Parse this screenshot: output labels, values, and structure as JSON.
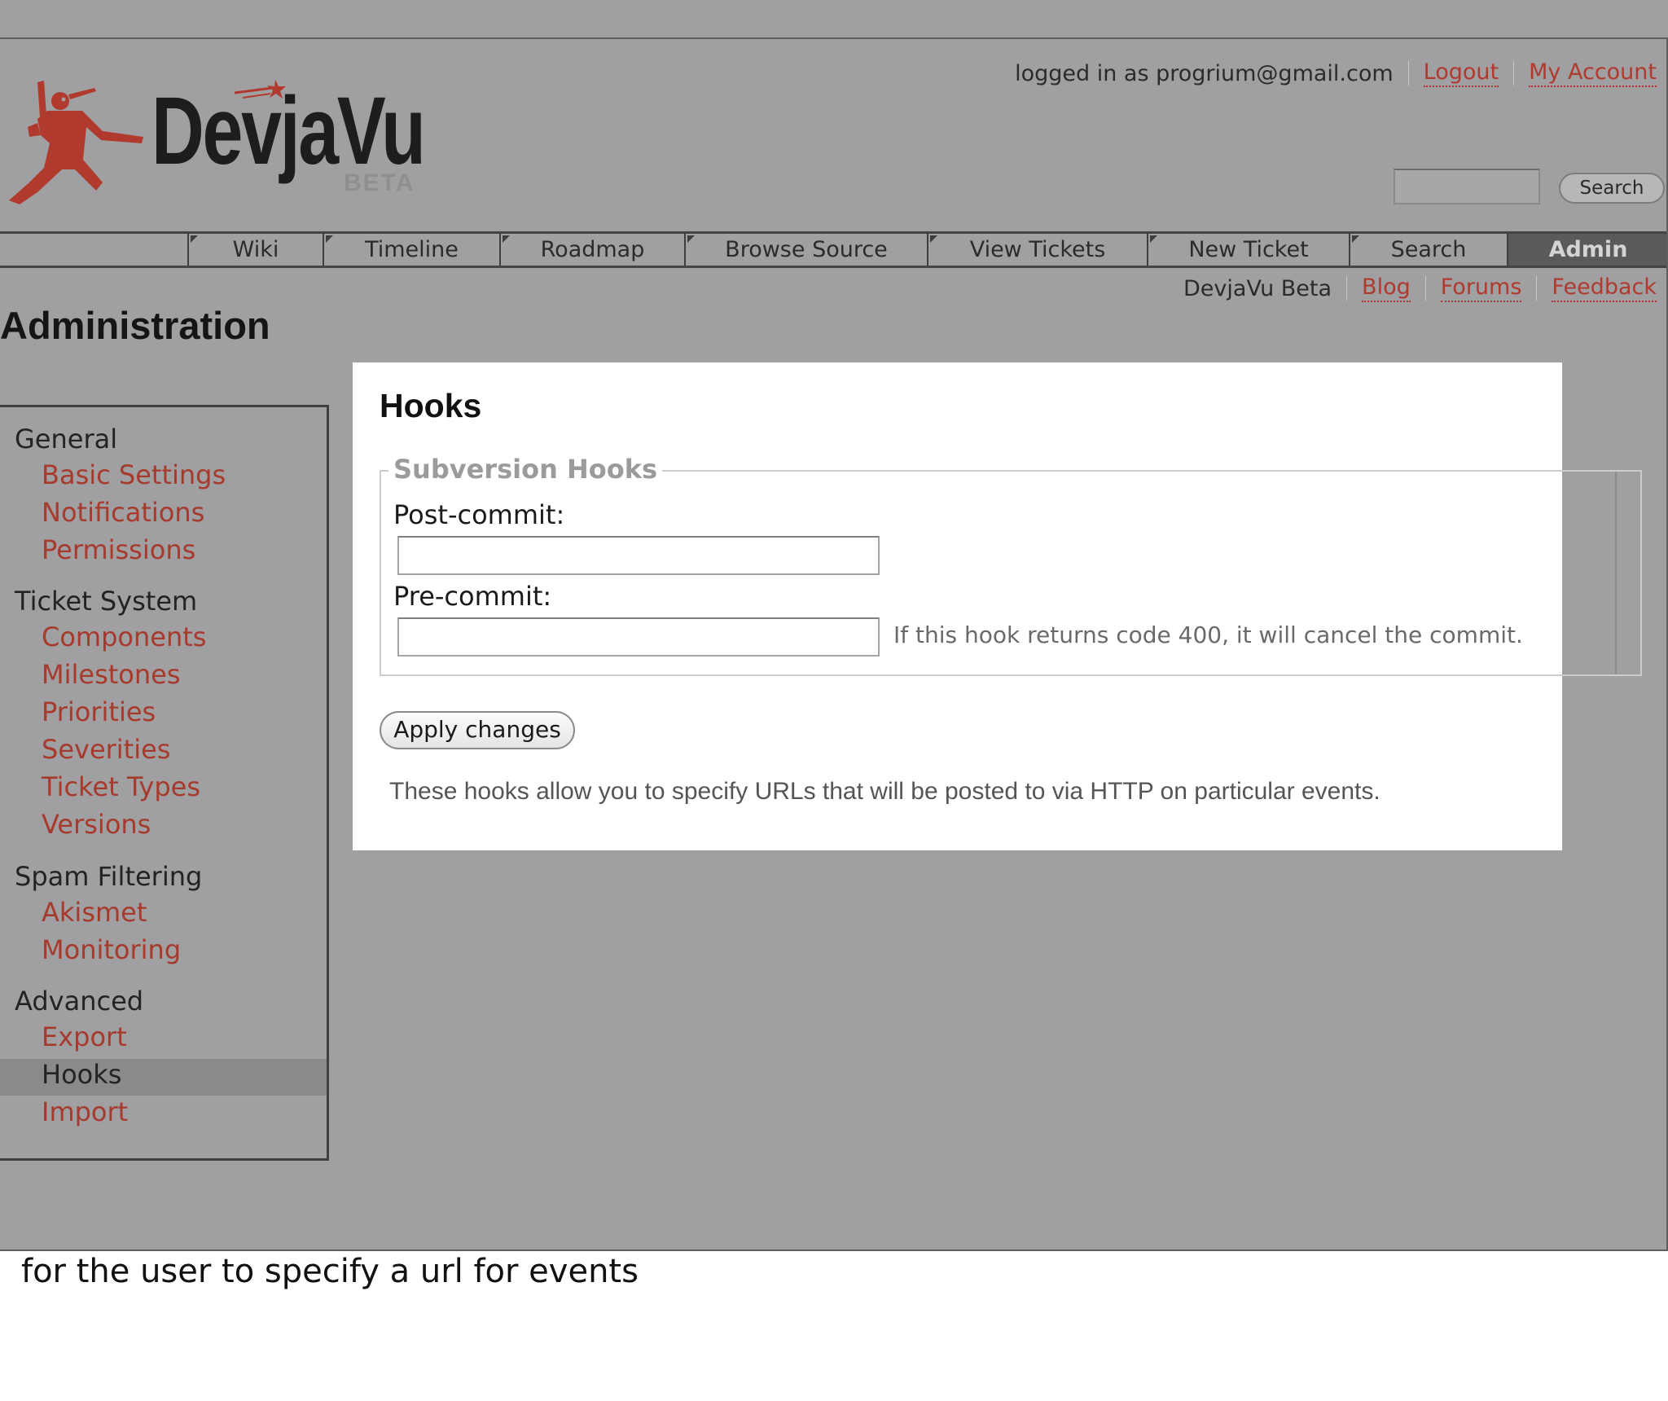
{
  "brand": {
    "name": "DevjaVu",
    "badge": "BETA",
    "logo_color": "#b03a2e"
  },
  "metanav": {
    "logged_in": "logged in as progrium@gmail.com",
    "logout": "Logout",
    "my_account": "My Account"
  },
  "search": {
    "value": "",
    "button": "Search"
  },
  "mainnav": {
    "tabs": [
      {
        "label": "Wiki",
        "active": false
      },
      {
        "label": "Timeline",
        "active": false
      },
      {
        "label": "Roadmap",
        "active": false
      },
      {
        "label": "Browse Source",
        "active": false
      },
      {
        "label": "View Tickets",
        "active": false
      },
      {
        "label": "New Ticket",
        "active": false
      },
      {
        "label": "Search",
        "active": false
      },
      {
        "label": "Admin",
        "active": true
      }
    ]
  },
  "ctxnav": {
    "items": [
      "DevjaVu Beta",
      "Blog",
      "Forums",
      "Feedback"
    ]
  },
  "page_title": "Administration",
  "sidebar": {
    "sections": [
      {
        "label": "General",
        "items": [
          "Basic Settings",
          "Notifications",
          "Permissions"
        ]
      },
      {
        "label": "Ticket System",
        "items": [
          "Components",
          "Milestones",
          "Priorities",
          "Severities",
          "Ticket Types",
          "Versions"
        ]
      },
      {
        "label": "Spam Filtering",
        "items": [
          "Akismet",
          "Monitoring"
        ]
      },
      {
        "label": "Advanced",
        "items": [
          "Export",
          "Hooks",
          "Import"
        ]
      }
    ],
    "selected": "Hooks"
  },
  "panel": {
    "title": "Hooks",
    "legend": "Subversion Hooks",
    "post_commit_label": "Post-commit:",
    "post_commit_value": "",
    "pre_commit_label": "Pre-commit:",
    "pre_commit_value": "",
    "pre_commit_hint": "If this hook returns code 400, it will cancel the commit.",
    "apply_button": "Apply changes",
    "description": "These hooks allow you to specify URLs that will be posted to via HTTP on particular events."
  },
  "caption": "for the user to specify a url for events"
}
